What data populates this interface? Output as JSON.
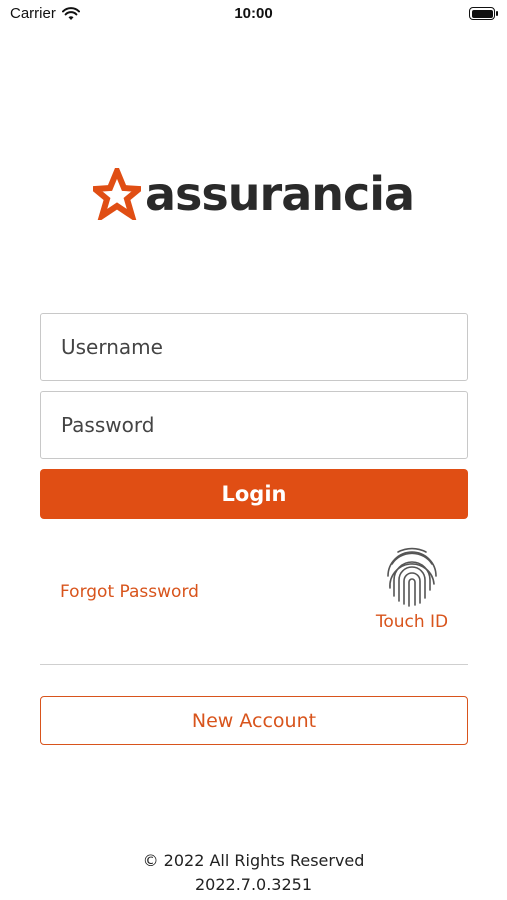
{
  "status_bar": {
    "carrier": "Carrier",
    "time": "10:00",
    "wifi_icon": "wifi-icon",
    "battery_icon": "battery-icon",
    "battery_level": 1.0
  },
  "brand": {
    "name": "assurancia",
    "logo_icon": "star-logo-icon",
    "accent_color": "#e04e14",
    "text_color": "#2a2a2a"
  },
  "login_form": {
    "username_placeholder": "Username",
    "username_value": "",
    "password_placeholder": "Password",
    "password_value": "",
    "login_label": "Login"
  },
  "links": {
    "forgot_password": "Forgot Password",
    "touch_id": "Touch ID",
    "touch_id_icon": "fingerprint-icon"
  },
  "new_account_label": "New Account",
  "footer": {
    "copyright": "© 2022 All Rights Reserved",
    "version": "2022.7.0.3251"
  }
}
